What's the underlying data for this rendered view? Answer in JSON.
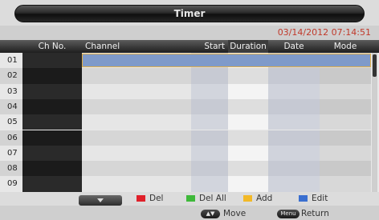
{
  "window": {
    "title": "Timer"
  },
  "datetime": "03/14/2012 07:14:51",
  "columns": {
    "ch_no": "Ch No.",
    "channel": "Channel",
    "start": "Start",
    "duration": "Duration",
    "date": "Date",
    "mode": "Mode"
  },
  "rows": [
    "01",
    "02",
    "03",
    "04",
    "05",
    "06",
    "07",
    "08",
    "09"
  ],
  "selected_row": "01",
  "legend": {
    "del": "Del",
    "del_all": "Del All",
    "add": "Add",
    "edit": "Edit"
  },
  "keys": {
    "move_icon": "▲▼",
    "move_label": "Move",
    "menu_icon": "Menu",
    "return_label": "Return"
  },
  "colors": {
    "datetime": "#c0392b",
    "selection": "#7f9ac9",
    "selection_border": "#e2b04a",
    "del": "#e0202a",
    "del_all": "#3fb93a",
    "add": "#f2b928",
    "edit": "#3a6fd0"
  }
}
